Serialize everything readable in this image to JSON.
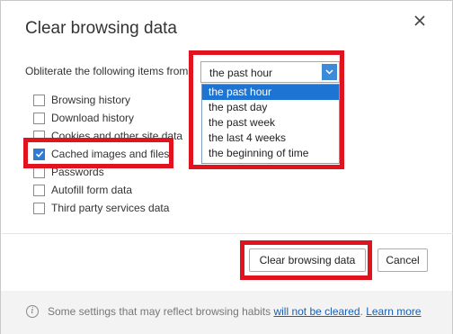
{
  "dialog": {
    "title": "Clear browsing data",
    "prompt": "Obliterate the following items from",
    "range_select": {
      "value": "the past hour",
      "options": [
        "the past hour",
        "the past day",
        "the past week",
        "the last 4 weeks",
        "the beginning of time"
      ],
      "selected_index": 0
    },
    "items": [
      {
        "label": "Browsing history",
        "checked": false
      },
      {
        "label": "Download history",
        "checked": false
      },
      {
        "label": "Cookies and other site data",
        "checked": false
      },
      {
        "label": "Cached images and files",
        "checked": true
      },
      {
        "label": "Passwords",
        "checked": false
      },
      {
        "label": "Autofill form data",
        "checked": false
      },
      {
        "label": "Third party services data",
        "checked": false
      }
    ],
    "buttons": {
      "clear": "Clear browsing data",
      "cancel": "Cancel"
    },
    "footer": {
      "text_before": "Some settings that may reflect browsing habits ",
      "link_not_cleared": "will not be cleared",
      "period": ". ",
      "link_learn_more": "Learn more"
    }
  },
  "colors": {
    "highlight": "#e0141e",
    "accent": "#1e74d3",
    "link": "#1a5fb4"
  },
  "icons": {
    "close": "close-icon",
    "dropdown": "chevron-down-icon",
    "check": "checkmark-icon",
    "info": "info-icon"
  }
}
